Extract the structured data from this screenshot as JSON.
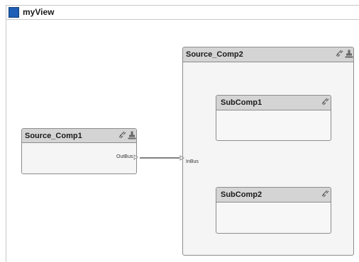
{
  "view": {
    "title": "myView",
    "icon": "view-icon",
    "icon_color": "#1f5fb5"
  },
  "components": {
    "source_comp1": {
      "title": "Source_Comp1",
      "icons": [
        "link-icon",
        "stamp-icon"
      ],
      "ports": {
        "out": "OutBus"
      }
    },
    "source_comp2": {
      "title": "Source_Comp2",
      "icons": [
        "link-icon",
        "stamp-icon"
      ],
      "ports": {
        "in": "InBus"
      },
      "subcomponents": [
        {
          "title": "SubComp1",
          "icon": "link-icon"
        },
        {
          "title": "SubComp2",
          "icon": "link-icon"
        }
      ]
    }
  },
  "colors": {
    "header": "#d4d4d4",
    "body": "#f5f5f5",
    "border": "#8c8c8c",
    "connector": "#000000"
  }
}
